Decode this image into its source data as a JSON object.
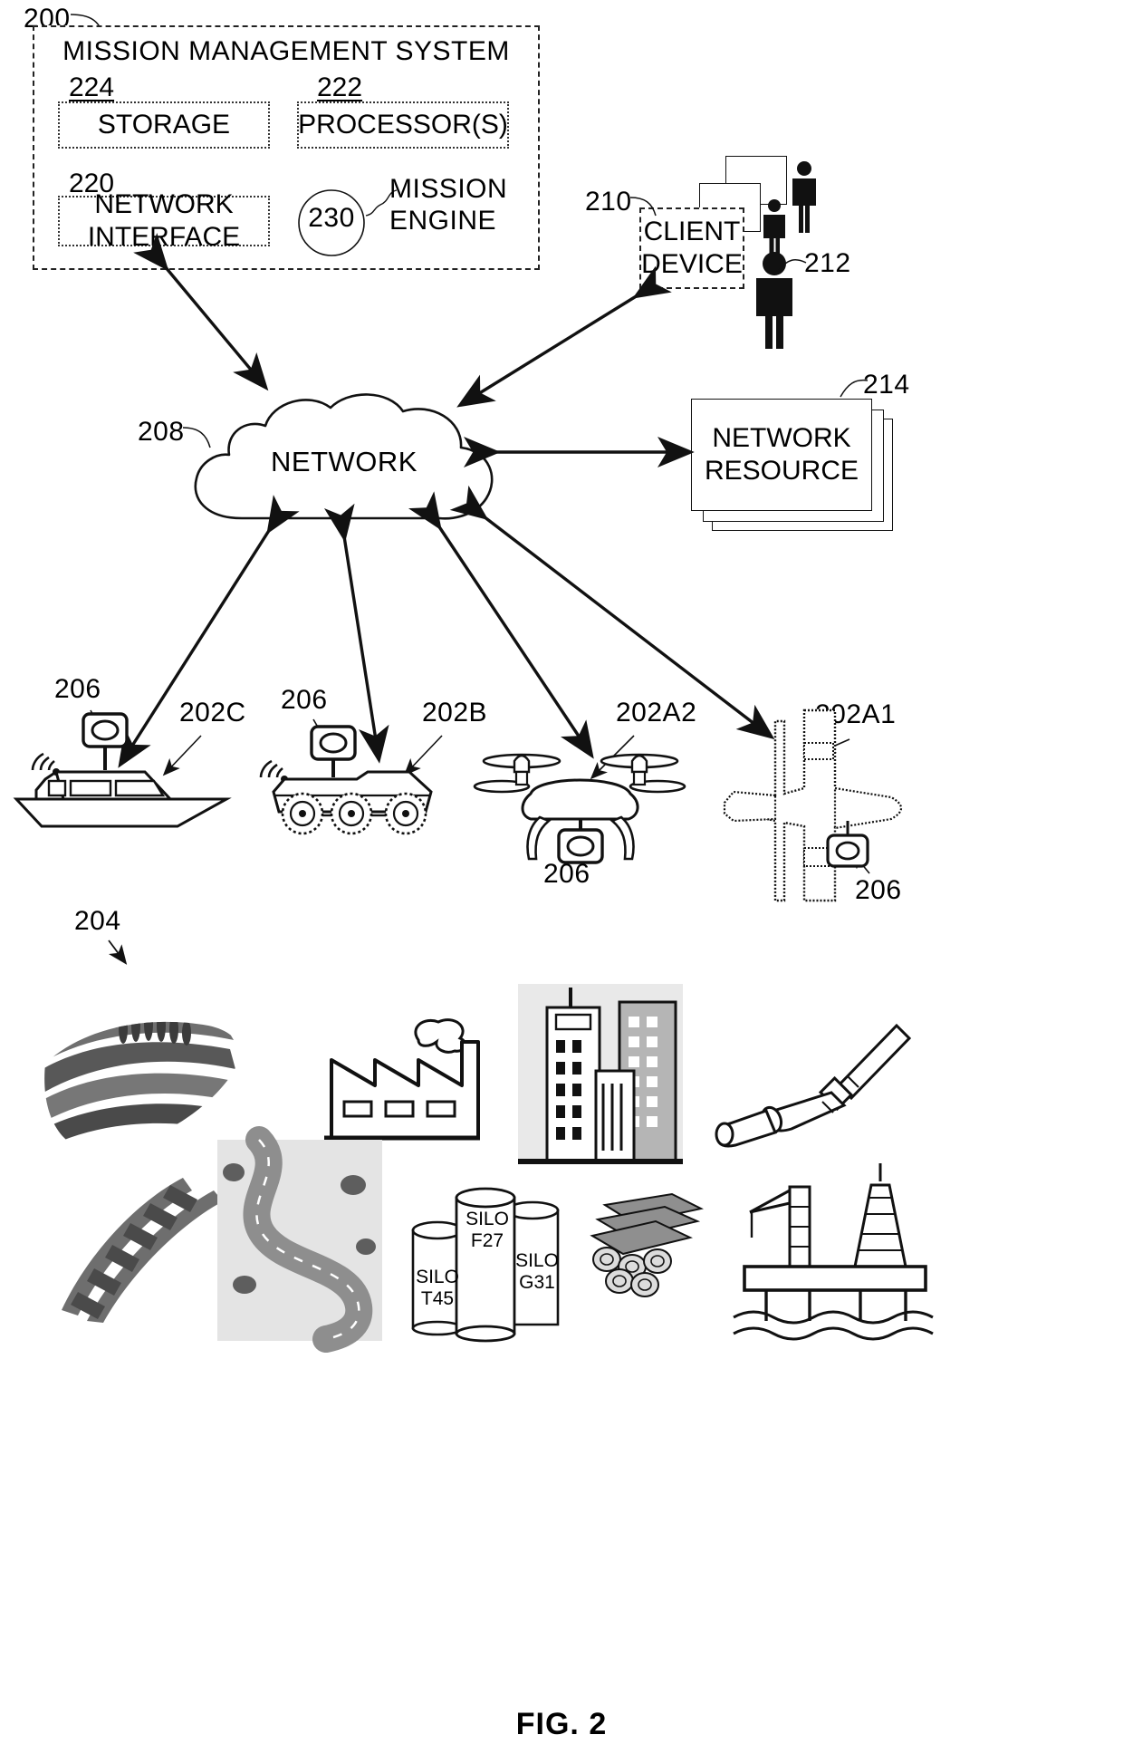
{
  "figure": {
    "caption": "FIG. 2",
    "root_ref": "200"
  },
  "mission_management_system": {
    "title": "MISSION MANAGEMENT SYSTEM",
    "ref": "200",
    "components": [
      {
        "ref": "224",
        "label": "STORAGE"
      },
      {
        "ref": "222",
        "label": "PROCESSOR(S)"
      },
      {
        "ref": "220",
        "label": "NETWORK\nINTERFACE"
      },
      {
        "ref": "230",
        "label": "MISSION\nENGINE"
      }
    ]
  },
  "client": {
    "ref": "210",
    "label": "CLIENT\nDEVICE",
    "user_ref": "212"
  },
  "network": {
    "ref": "208",
    "label": "NETWORK"
  },
  "network_resource": {
    "ref": "214",
    "label": "NETWORK\nRESOURCE"
  },
  "vehicles": [
    {
      "ref": "202C",
      "name": "boat",
      "sensor_ref": "206"
    },
    {
      "ref": "202B",
      "name": "ground-vehicle",
      "sensor_ref": "206"
    },
    {
      "ref": "202A2",
      "name": "quadcopter",
      "sensor_ref": "206"
    },
    {
      "ref": "202A1",
      "name": "airplane",
      "sensor_ref": "206"
    }
  ],
  "sensor": {
    "ref": "206",
    "name": "camera-sensor"
  },
  "assets": {
    "ref": "204",
    "items": [
      {
        "name": "terraced-field"
      },
      {
        "name": "factory"
      },
      {
        "name": "city-buildings"
      },
      {
        "name": "pipeline"
      },
      {
        "name": "railroad-track"
      },
      {
        "name": "winding-road"
      },
      {
        "name": "silos"
      },
      {
        "name": "log-pile"
      },
      {
        "name": "offshore-oil-rig"
      }
    ],
    "silos": [
      {
        "line1": "SILO",
        "line2": "T45"
      },
      {
        "line1": "SILO",
        "line2": "F27"
      },
      {
        "line1": "SILO",
        "line2": "G31"
      }
    ]
  },
  "colors": {
    "ink": "#111111",
    "fill": "#ffffff",
    "gray_light": "#cccccc",
    "gray_mid": "#9a9a9a",
    "gray_dark": "#5a5a5a"
  }
}
